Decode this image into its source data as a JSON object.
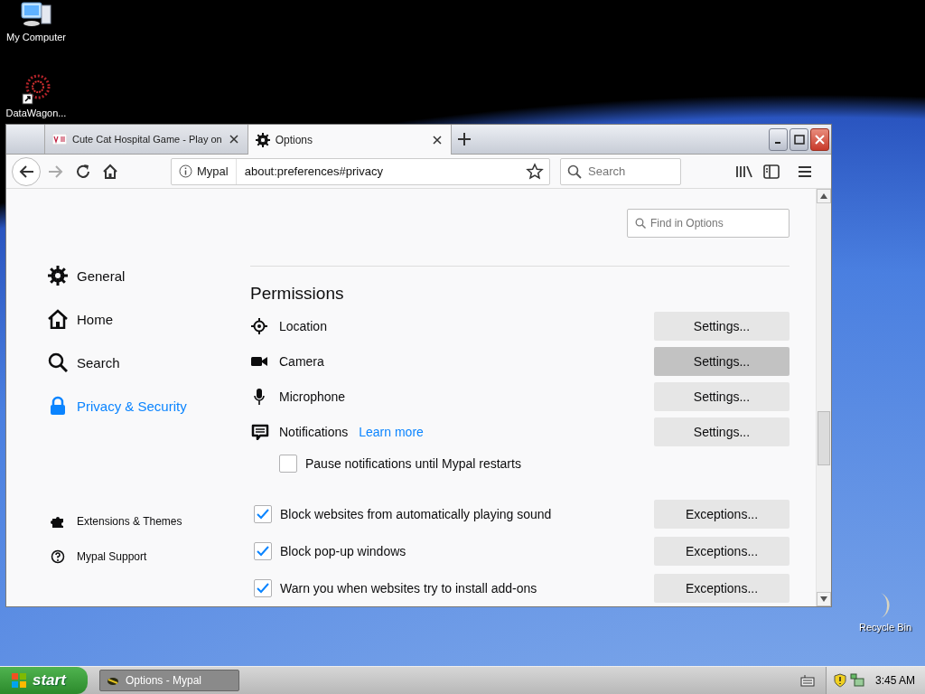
{
  "desktop_icons": [
    {
      "kind": "computer",
      "label": "My Computer"
    },
    {
      "kind": "shortcut",
      "label": "DataWagon..."
    },
    {
      "kind": "bin",
      "label": "Recycle Bin"
    }
  ],
  "browser": {
    "tabs": [
      {
        "kind": "site",
        "title": "Cute Cat Hospital Game - Play on",
        "selected": false
      },
      {
        "kind": "options",
        "title": "Options",
        "selected": true
      }
    ],
    "toolbar": {
      "identity": "Mypal",
      "url": "about:preferences#privacy",
      "search_placeholder": "Search"
    },
    "sidebar": {
      "categories": [
        {
          "kind": "general",
          "label": "General",
          "selected": false
        },
        {
          "kind": "home",
          "label": "Home",
          "selected": false
        },
        {
          "kind": "search",
          "label": "Search",
          "selected": false
        },
        {
          "kind": "privacy",
          "label": "Privacy & Security",
          "selected": true
        }
      ],
      "footer": [
        {
          "kind": "extensions",
          "label": "Extensions & Themes"
        },
        {
          "kind": "support",
          "label": "Mypal Support"
        }
      ]
    },
    "find_placeholder": "Find in Options",
    "permissions": {
      "heading": "Permissions",
      "rows": [
        {
          "kind": "location",
          "label": "Location",
          "button": "Settings...",
          "hovered": false
        },
        {
          "kind": "camera",
          "label": "Camera",
          "button": "Settings...",
          "hovered": true
        },
        {
          "kind": "microphone",
          "label": "Microphone",
          "button": "Settings...",
          "hovered": false
        },
        {
          "kind": "notifications",
          "label": "Notifications",
          "link": "Learn more",
          "button": "Settings...",
          "hovered": false
        }
      ],
      "pause": {
        "label": "Pause notifications until Mypal restarts",
        "checked": false
      },
      "options": [
        {
          "label": "Block websites from automatically playing sound",
          "checked": true,
          "button": "Exceptions..."
        },
        {
          "label": "Block pop-up windows",
          "checked": true,
          "button": "Exceptions..."
        },
        {
          "label": "Warn you when websites try to install add-ons",
          "checked": true,
          "button": "Exceptions..."
        }
      ]
    }
  },
  "taskbar": {
    "start": "start",
    "task": "Options - Mypal",
    "clock": "3:45 AM"
  }
}
